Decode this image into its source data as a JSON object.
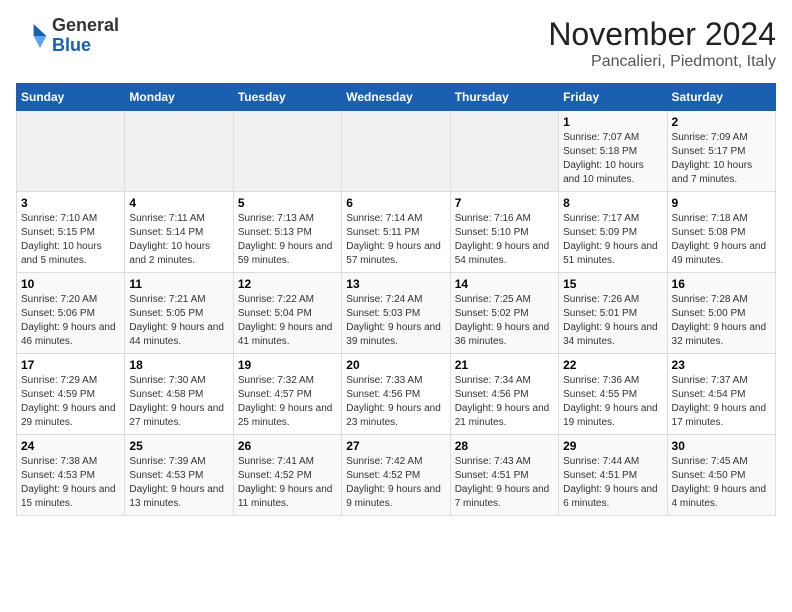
{
  "header": {
    "logo_line1": "General",
    "logo_line2": "Blue",
    "month": "November 2024",
    "location": "Pancalieri, Piedmont, Italy"
  },
  "weekdays": [
    "Sunday",
    "Monday",
    "Tuesday",
    "Wednesday",
    "Thursday",
    "Friday",
    "Saturday"
  ],
  "weeks": [
    [
      {
        "day": "",
        "info": ""
      },
      {
        "day": "",
        "info": ""
      },
      {
        "day": "",
        "info": ""
      },
      {
        "day": "",
        "info": ""
      },
      {
        "day": "",
        "info": ""
      },
      {
        "day": "1",
        "info": "Sunrise: 7:07 AM\nSunset: 5:18 PM\nDaylight: 10 hours and 10 minutes."
      },
      {
        "day": "2",
        "info": "Sunrise: 7:09 AM\nSunset: 5:17 PM\nDaylight: 10 hours and 7 minutes."
      }
    ],
    [
      {
        "day": "3",
        "info": "Sunrise: 7:10 AM\nSunset: 5:15 PM\nDaylight: 10 hours and 5 minutes."
      },
      {
        "day": "4",
        "info": "Sunrise: 7:11 AM\nSunset: 5:14 PM\nDaylight: 10 hours and 2 minutes."
      },
      {
        "day": "5",
        "info": "Sunrise: 7:13 AM\nSunset: 5:13 PM\nDaylight: 9 hours and 59 minutes."
      },
      {
        "day": "6",
        "info": "Sunrise: 7:14 AM\nSunset: 5:11 PM\nDaylight: 9 hours and 57 minutes."
      },
      {
        "day": "7",
        "info": "Sunrise: 7:16 AM\nSunset: 5:10 PM\nDaylight: 9 hours and 54 minutes."
      },
      {
        "day": "8",
        "info": "Sunrise: 7:17 AM\nSunset: 5:09 PM\nDaylight: 9 hours and 51 minutes."
      },
      {
        "day": "9",
        "info": "Sunrise: 7:18 AM\nSunset: 5:08 PM\nDaylight: 9 hours and 49 minutes."
      }
    ],
    [
      {
        "day": "10",
        "info": "Sunrise: 7:20 AM\nSunset: 5:06 PM\nDaylight: 9 hours and 46 minutes."
      },
      {
        "day": "11",
        "info": "Sunrise: 7:21 AM\nSunset: 5:05 PM\nDaylight: 9 hours and 44 minutes."
      },
      {
        "day": "12",
        "info": "Sunrise: 7:22 AM\nSunset: 5:04 PM\nDaylight: 9 hours and 41 minutes."
      },
      {
        "day": "13",
        "info": "Sunrise: 7:24 AM\nSunset: 5:03 PM\nDaylight: 9 hours and 39 minutes."
      },
      {
        "day": "14",
        "info": "Sunrise: 7:25 AM\nSunset: 5:02 PM\nDaylight: 9 hours and 36 minutes."
      },
      {
        "day": "15",
        "info": "Sunrise: 7:26 AM\nSunset: 5:01 PM\nDaylight: 9 hours and 34 minutes."
      },
      {
        "day": "16",
        "info": "Sunrise: 7:28 AM\nSunset: 5:00 PM\nDaylight: 9 hours and 32 minutes."
      }
    ],
    [
      {
        "day": "17",
        "info": "Sunrise: 7:29 AM\nSunset: 4:59 PM\nDaylight: 9 hours and 29 minutes."
      },
      {
        "day": "18",
        "info": "Sunrise: 7:30 AM\nSunset: 4:58 PM\nDaylight: 9 hours and 27 minutes."
      },
      {
        "day": "19",
        "info": "Sunrise: 7:32 AM\nSunset: 4:57 PM\nDaylight: 9 hours and 25 minutes."
      },
      {
        "day": "20",
        "info": "Sunrise: 7:33 AM\nSunset: 4:56 PM\nDaylight: 9 hours and 23 minutes."
      },
      {
        "day": "21",
        "info": "Sunrise: 7:34 AM\nSunset: 4:56 PM\nDaylight: 9 hours and 21 minutes."
      },
      {
        "day": "22",
        "info": "Sunrise: 7:36 AM\nSunset: 4:55 PM\nDaylight: 9 hours and 19 minutes."
      },
      {
        "day": "23",
        "info": "Sunrise: 7:37 AM\nSunset: 4:54 PM\nDaylight: 9 hours and 17 minutes."
      }
    ],
    [
      {
        "day": "24",
        "info": "Sunrise: 7:38 AM\nSunset: 4:53 PM\nDaylight: 9 hours and 15 minutes."
      },
      {
        "day": "25",
        "info": "Sunrise: 7:39 AM\nSunset: 4:53 PM\nDaylight: 9 hours and 13 minutes."
      },
      {
        "day": "26",
        "info": "Sunrise: 7:41 AM\nSunset: 4:52 PM\nDaylight: 9 hours and 11 minutes."
      },
      {
        "day": "27",
        "info": "Sunrise: 7:42 AM\nSunset: 4:52 PM\nDaylight: 9 hours and 9 minutes."
      },
      {
        "day": "28",
        "info": "Sunrise: 7:43 AM\nSunset: 4:51 PM\nDaylight: 9 hours and 7 minutes."
      },
      {
        "day": "29",
        "info": "Sunrise: 7:44 AM\nSunset: 4:51 PM\nDaylight: 9 hours and 6 minutes."
      },
      {
        "day": "30",
        "info": "Sunrise: 7:45 AM\nSunset: 4:50 PM\nDaylight: 9 hours and 4 minutes."
      }
    ]
  ]
}
